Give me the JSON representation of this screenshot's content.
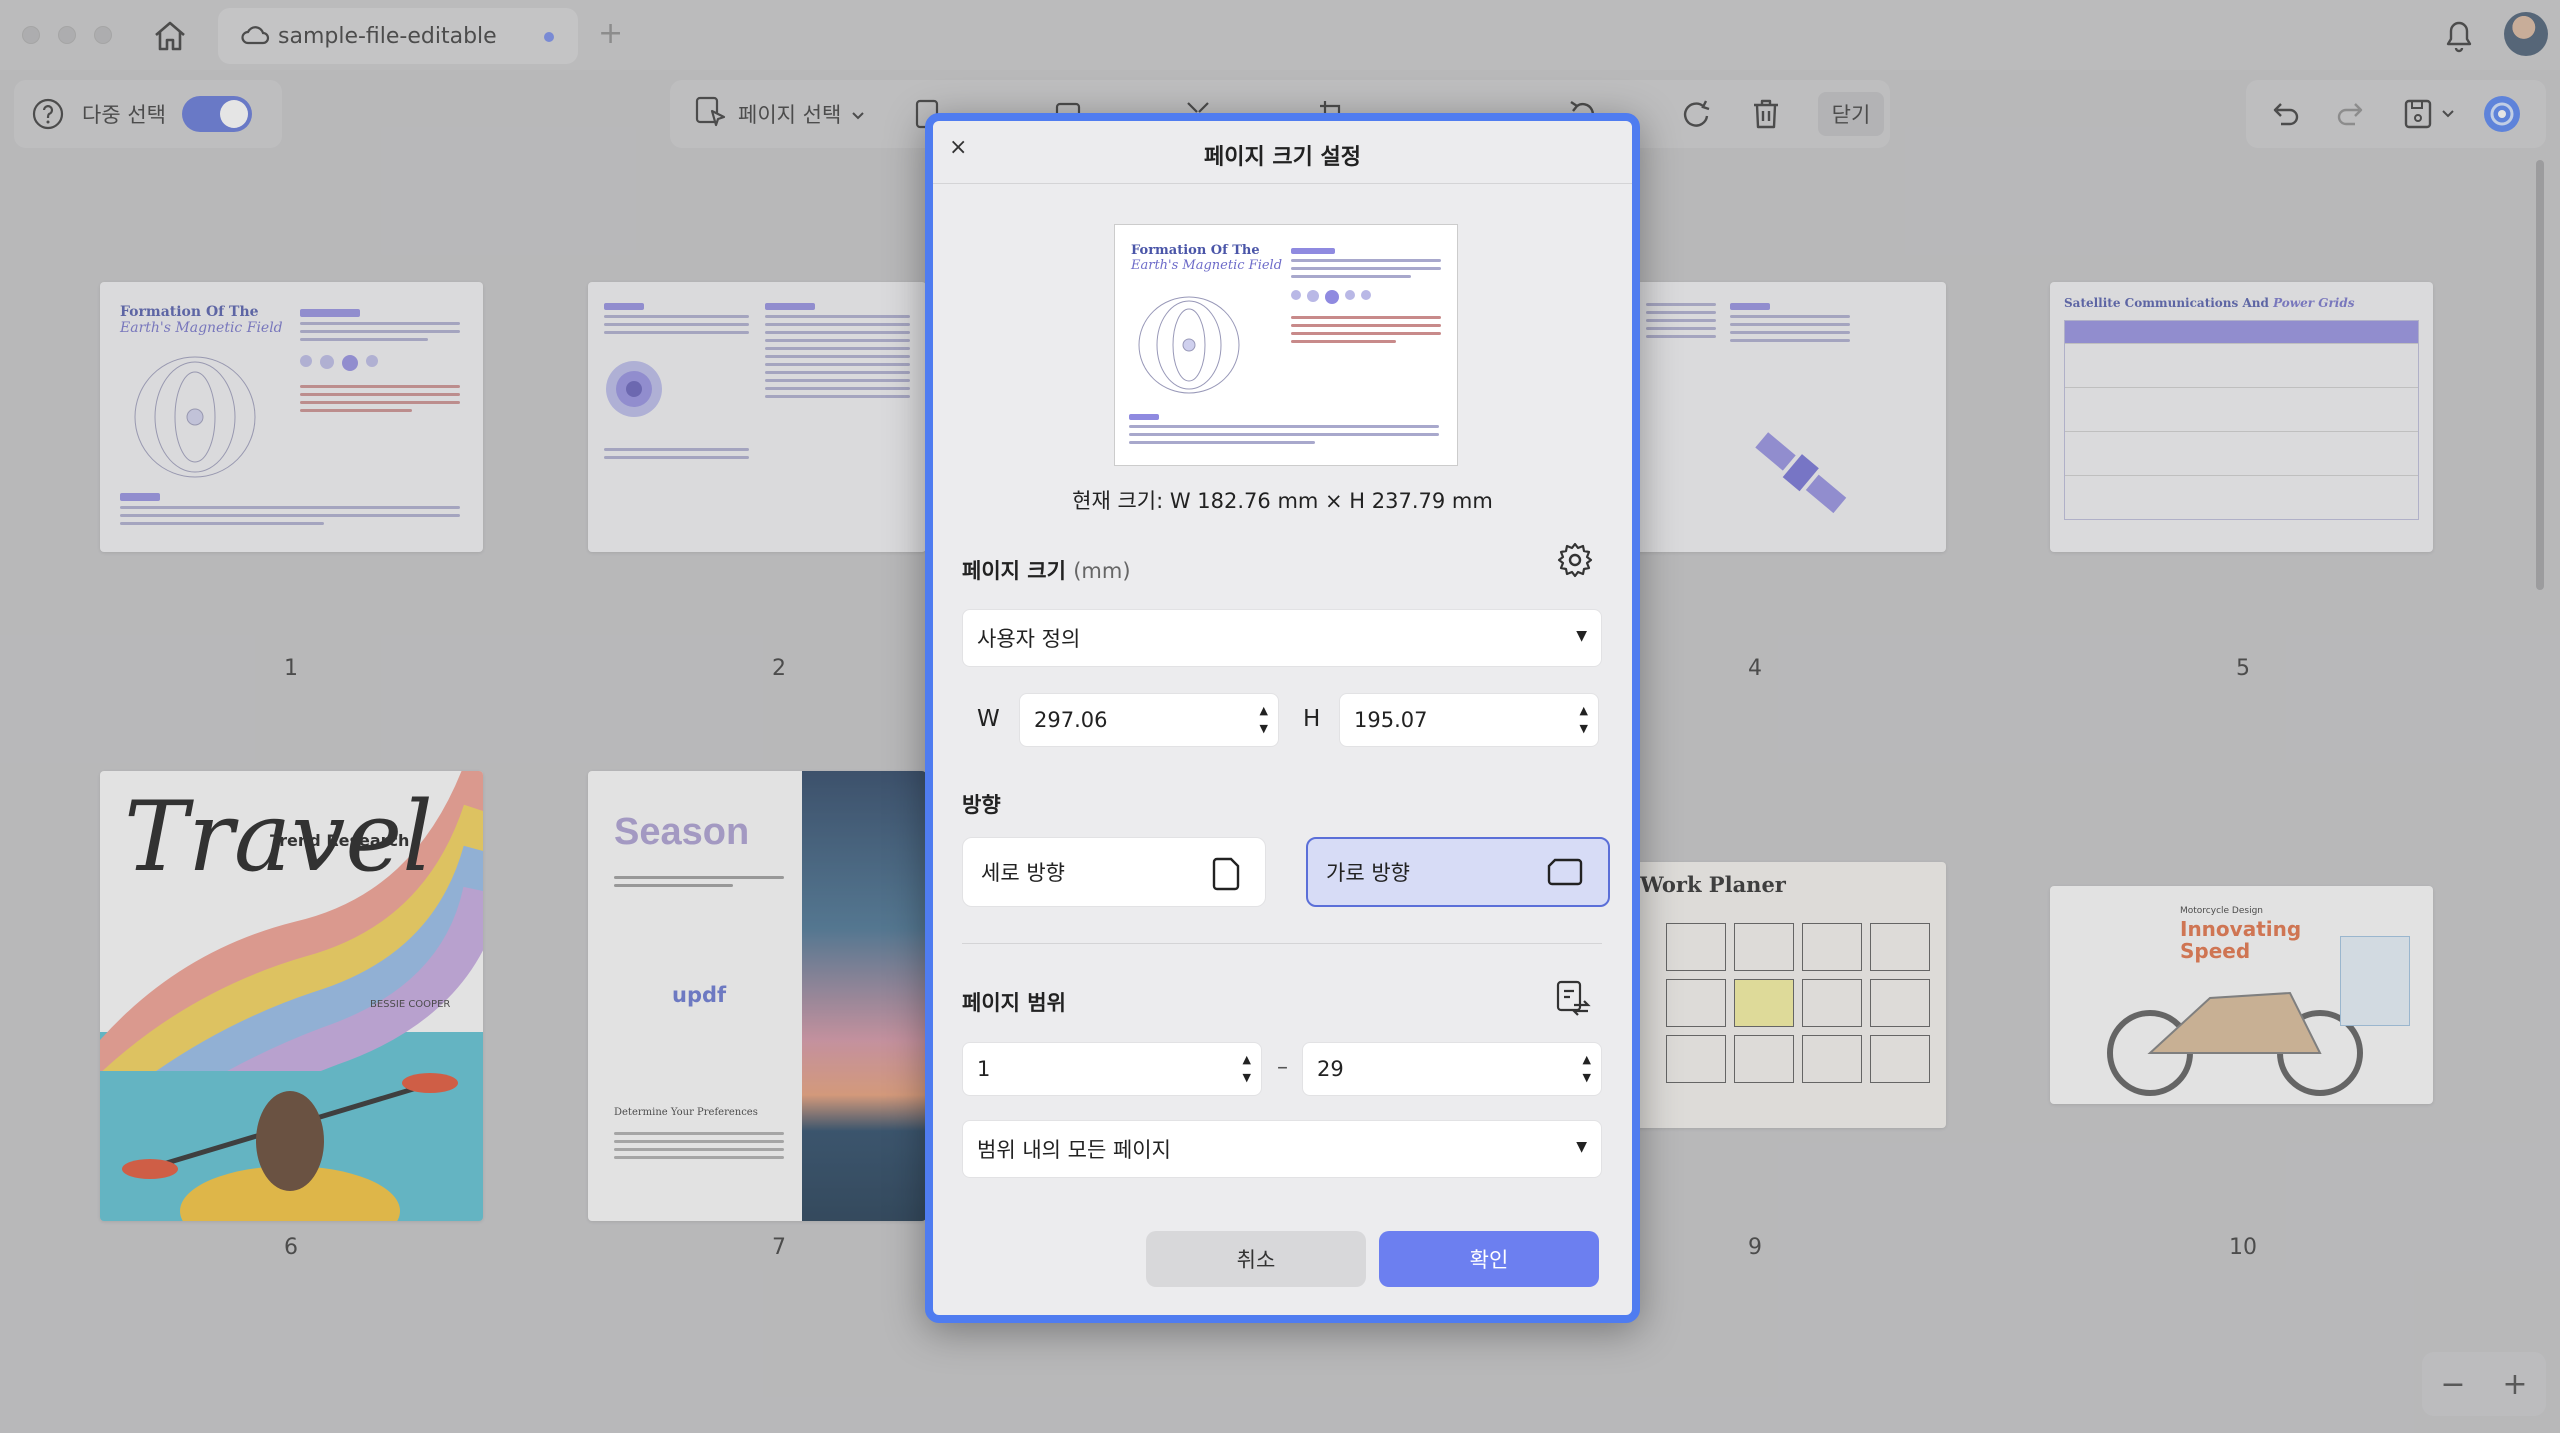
{
  "window": {
    "tab_title": "sample-file-editable",
    "new_tab": "+"
  },
  "toolbar": {
    "multi_select_label": "다중 선택",
    "multi_select_on": true,
    "page_select_label": "페이지 선택",
    "close_label": "닫기"
  },
  "thumbnails": {
    "page_numbers": [
      "1",
      "2",
      "4",
      "5",
      "6",
      "7",
      "9",
      "10"
    ],
    "p1_title": "Formation Of The",
    "p1_subtitle": "Earth's Magnetic Field",
    "p5_title": "Satellite Communications And ",
    "p5_title_em": "Power Grids",
    "p6_word": "Travel",
    "p6_trend": "Trend Research",
    "p6_author": "BESSIE COOPER",
    "p7_title": "Season",
    "p7_brand": "updf",
    "p7_heading": "Determine Your Preferences",
    "p9_title": "Work Planer",
    "p10_brand": "Motorcycle Design",
    "p10_title": "Innovating Speed"
  },
  "dialog": {
    "title": "페이지 크기 설정",
    "close": "×",
    "preview_title": "Formation Of The",
    "preview_subtitle": "Earth's Magnetic Field",
    "current_size": "현재 크기: W 182.76 mm × H 237.79 mm",
    "page_size_label": "페이지 크기",
    "page_size_unit": "(mm)",
    "size_preset": "사용자 정의",
    "w_label": "W",
    "w_value": "297.06",
    "h_label": "H",
    "h_value": "195.07",
    "orientation_label": "방향",
    "portrait_label": "세로 방향",
    "landscape_label": "가로 방향",
    "orientation_selected": "landscape",
    "range_label": "페이지 범위",
    "range_from": "1",
    "range_dash": "–",
    "range_to": "29",
    "range_mode": "범위 내의 모든 페이지",
    "cancel": "취소",
    "ok": "확인"
  },
  "zoom": {
    "minus": "−",
    "plus": "+"
  },
  "colors": {
    "accent": "#4f7cf0",
    "primary_button": "#6c7ff0",
    "toggle": "#5a6fd6"
  }
}
